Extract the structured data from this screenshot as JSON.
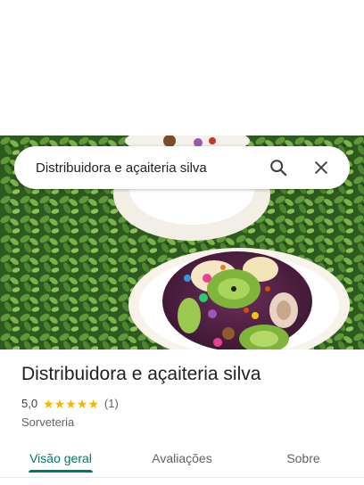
{
  "search": {
    "query": "Distribuidora e açaiteria silva",
    "search_icon": "search-icon",
    "close_icon": "close-icon"
  },
  "place": {
    "name": "Distribuidora e açaiteria silva",
    "rating": "5,0",
    "stars": 5,
    "review_count": "(1)",
    "category": "Sorveteria"
  },
  "tabs": [
    {
      "label": "Visão geral",
      "active": true
    },
    {
      "label": "Avaliações",
      "active": false
    },
    {
      "label": "Sobre",
      "active": false
    }
  ],
  "colors": {
    "accent": "#00796b",
    "star": "#f6b600"
  }
}
